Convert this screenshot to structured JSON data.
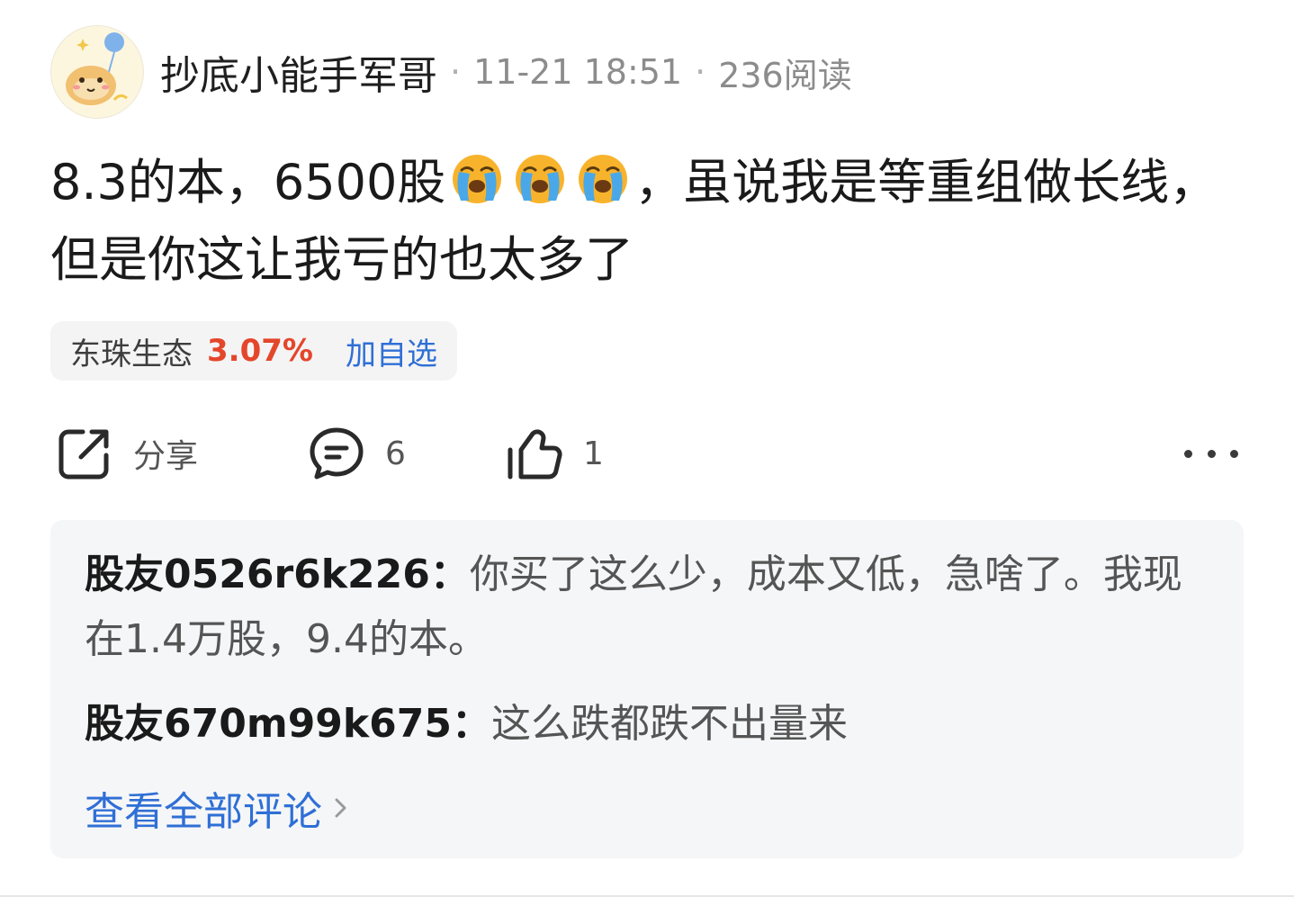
{
  "post": {
    "author": "抄底小能手军哥",
    "date": "11-21 18:51",
    "reads": "236阅读",
    "text_before_emoji": "8.3的本，6500股",
    "emoji": [
      "crying-emoji",
      "crying-emoji",
      "crying-emoji"
    ],
    "text_after_emoji": "，虽说我是等重组做长线，但是你这让我亏的也太多了"
  },
  "stock": {
    "name": "东珠生态",
    "change": "3.07%",
    "add_label": "加自选"
  },
  "actions": {
    "share_label": "分享",
    "comment_count": "6",
    "like_count": "1"
  },
  "comments": [
    {
      "user": "股友0526r6k226",
      "sep": "：",
      "text": "你买了这么少，成本又低，急啥了。我现在1.4万股，9.4的本。"
    },
    {
      "user": "股友670m99k675",
      "sep": "：",
      "text": "这么跌都跌不出量来"
    }
  ],
  "view_all_label": "查看全部评论",
  "colors": {
    "accent_blue": "#2f6fd6",
    "stock_up_red": "#e4462b"
  }
}
